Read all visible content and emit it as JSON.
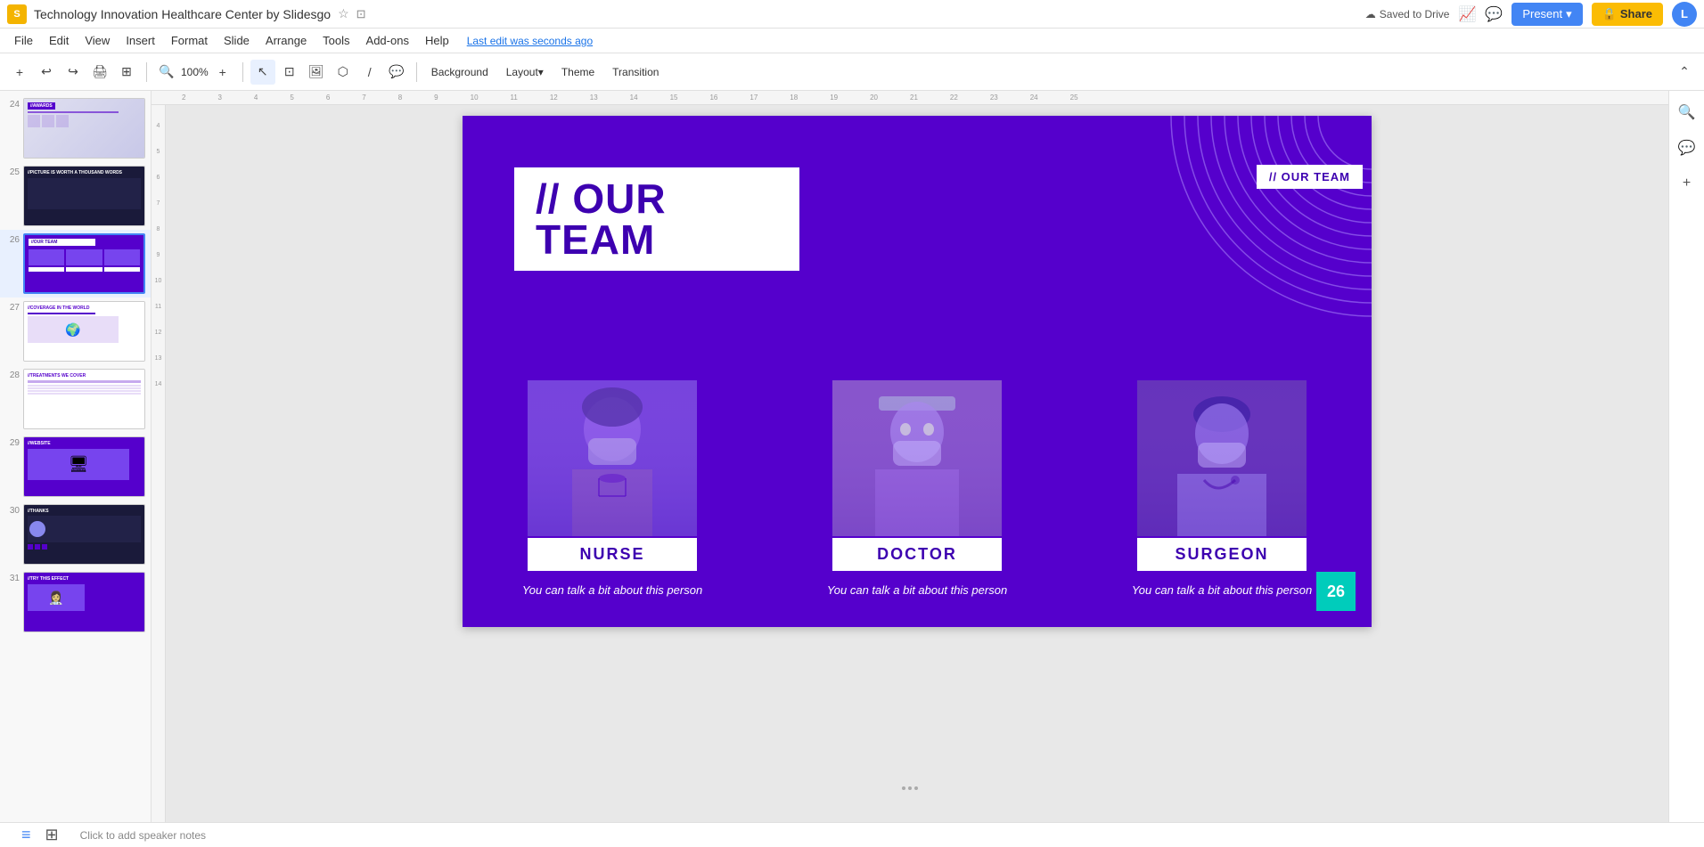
{
  "app": {
    "icon_label": "S",
    "title": "Technology Innovation Healthcare Center by Slidesgo",
    "saved_status": "Saved to Drive",
    "last_edit": "Last edit was seconds ago"
  },
  "menu": {
    "items": [
      "File",
      "Edit",
      "View",
      "Insert",
      "Format",
      "Slide",
      "Arrange",
      "Tools",
      "Add-ons",
      "Help"
    ]
  },
  "toolbar": {
    "background_label": "Background",
    "layout_label": "Layout",
    "theme_label": "Theme",
    "transition_label": "Transition"
  },
  "present_btn": "Present",
  "share_btn": "Share",
  "avatar_letter": "L",
  "slide": {
    "number": "26",
    "title_prefix": "// ",
    "title": "OUR TEAM",
    "top_right_label": "// OUR TEAM",
    "members": [
      {
        "role": "NURSE",
        "description": "You can talk a bit\nabout this person"
      },
      {
        "role": "DOCTOR",
        "description": "You can talk a bit\nabout this person"
      },
      {
        "role": "SURGEON",
        "description": "You can talk a bit\nabout this person"
      }
    ]
  },
  "slides": [
    {
      "num": "24",
      "type": "light"
    },
    {
      "num": "25",
      "type": "dark"
    },
    {
      "num": "26",
      "type": "purple",
      "active": true
    },
    {
      "num": "27",
      "type": "white"
    },
    {
      "num": "28",
      "type": "white"
    },
    {
      "num": "29",
      "type": "purple"
    },
    {
      "num": "30",
      "type": "dark"
    },
    {
      "num": "31",
      "type": "purple"
    }
  ],
  "bottom_notes_placeholder": "Click to add speaker notes",
  "colors": {
    "purple": "#5500cc",
    "white": "#ffffff",
    "accent": "#00ccbb",
    "text_purple": "#3d00b0"
  }
}
